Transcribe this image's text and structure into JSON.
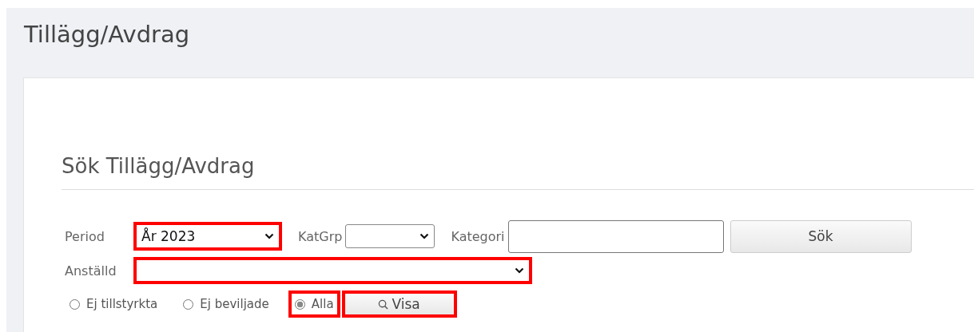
{
  "page_title": "Tillägg/Avdrag",
  "section_title": "Sök Tillägg/Avdrag",
  "search_row": [
    {
      "kind": "select",
      "label": "Period",
      "value": "År 2023",
      "highlighted": true
    },
    {
      "kind": "select",
      "label": "KatGrp",
      "highlighted": false
    },
    {
      "kind": "text",
      "label": "Kategori",
      "highlighted": false
    },
    {
      "kind": "button",
      "label": "Sök",
      "highlighted": false
    }
  ],
  "employee": {
    "label": "Anställd",
    "highlighted": true
  },
  "filters": [
    {
      "label": "Ej tillstyrkta",
      "selected": false,
      "highlighted": false
    },
    {
      "label": "Ej beviljade",
      "selected": false,
      "highlighted": false
    },
    {
      "label": "Alla",
      "selected": true,
      "highlighted": true
    }
  ],
  "show_button": {
    "label": "Visa",
    "highlighted": true
  }
}
